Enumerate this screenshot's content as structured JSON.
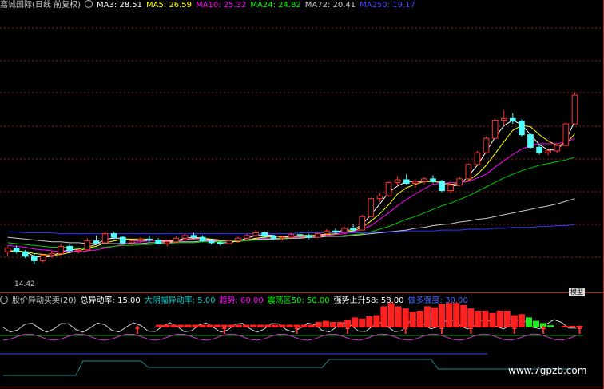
{
  "main_header": {
    "title": "嘉诚国际(日线 前复权)",
    "ma3": "MA3: 28.51",
    "ma5": "MA5: 26.59",
    "ma10": "MA10: 25.32",
    "ma24": "MA24: 24.82",
    "ma72": "MA72: 20.41",
    "ma250": "MA250: 19.17",
    "colors": {
      "title": "#c8c8c8",
      "ma3": "#ffffff",
      "ma5": "#ffff00",
      "ma10": "#ff00ff",
      "ma24": "#00ff00",
      "ma72": "#c8c8c8",
      "ma250": "#4444ff"
    }
  },
  "indicator_header": {
    "name": "股价异动买卖(20)",
    "total": "总异动率: 15.00",
    "big": "大阴幅异动率: 5.00",
    "trend": "趋势: 60.00",
    "zone": "震荡区50: 50.00",
    "strong": "强势上升58: 58.00",
    "bull": "做多强度: 30.00",
    "colors": {
      "name": "#c8c8c8",
      "total": "#ffffff",
      "big": "#00cccc",
      "trend": "#ff00ff",
      "zone": "#00ff00",
      "strong": "#ffffff",
      "bull": "#4466ff"
    }
  },
  "low_price_label": "14.42",
  "mini_tag": "模型",
  "watermark": "www.7gpzb.com",
  "chart_data": {
    "type": "candlestick",
    "price_range": [
      12,
      34
    ],
    "candles": [
      [
        15.8,
        16.4,
        15.3,
        16.2
      ],
      [
        16.2,
        16.5,
        15.6,
        15.8
      ],
      [
        15.8,
        16.0,
        15.1,
        15.3
      ],
      [
        15.3,
        15.6,
        14.4,
        14.8
      ],
      [
        14.8,
        15.6,
        14.6,
        15.4
      ],
      [
        15.4,
        15.9,
        15.1,
        15.6
      ],
      [
        15.6,
        16.7,
        15.4,
        16.4
      ],
      [
        16.4,
        16.6,
        15.7,
        15.9
      ],
      [
        15.9,
        16.3,
        15.6,
        16.0
      ],
      [
        16.0,
        17.3,
        15.9,
        17.0
      ],
      [
        17.0,
        17.6,
        16.5,
        16.8
      ],
      [
        16.8,
        18.1,
        16.7,
        17.8
      ],
      [
        17.8,
        18.0,
        17.2,
        17.4
      ],
      [
        17.4,
        17.5,
        16.6,
        16.8
      ],
      [
        16.8,
        17.1,
        16.5,
        17.0
      ],
      [
        17.0,
        17.4,
        16.8,
        17.2
      ],
      [
        17.2,
        17.6,
        16.9,
        17.1
      ],
      [
        17.1,
        17.3,
        16.6,
        16.7
      ],
      [
        16.7,
        17.0,
        16.4,
        16.9
      ],
      [
        16.9,
        17.5,
        16.8,
        17.3
      ],
      [
        17.3,
        17.8,
        17.1,
        17.6
      ],
      [
        17.6,
        17.9,
        17.2,
        17.4
      ],
      [
        17.4,
        17.6,
        16.9,
        17.0
      ],
      [
        17.0,
        17.2,
        16.6,
        16.8
      ],
      [
        16.8,
        17.0,
        16.5,
        16.7
      ],
      [
        16.7,
        17.1,
        16.6,
        17.0
      ],
      [
        17.0,
        17.5,
        16.8,
        17.3
      ],
      [
        17.3,
        17.8,
        17.1,
        17.6
      ],
      [
        17.6,
        18.2,
        17.4,
        17.9
      ],
      [
        17.9,
        18.0,
        17.3,
        17.5
      ],
      [
        17.5,
        17.7,
        17.1,
        17.3
      ],
      [
        17.3,
        17.6,
        17.0,
        17.4
      ],
      [
        17.4,
        17.9,
        17.2,
        17.7
      ],
      [
        17.7,
        18.0,
        17.4,
        17.6
      ],
      [
        17.6,
        17.8,
        17.2,
        17.4
      ],
      [
        17.4,
        17.9,
        17.3,
        17.8
      ],
      [
        17.8,
        18.3,
        17.6,
        18.1
      ],
      [
        18.1,
        18.4,
        17.8,
        18.0
      ],
      [
        18.0,
        18.6,
        17.9,
        18.4
      ],
      [
        18.4,
        18.9,
        18.1,
        18.2
      ],
      [
        18.2,
        19.9,
        18.2,
        19.7
      ],
      [
        19.7,
        21.8,
        19.6,
        21.7
      ],
      [
        21.7,
        22.3,
        21.3,
        22.0
      ],
      [
        22.0,
        23.6,
        21.9,
        23.5
      ],
      [
        23.5,
        24.2,
        23.1,
        23.8
      ],
      [
        23.8,
        24.4,
        23.2,
        23.4
      ],
      [
        23.4,
        23.9,
        22.9,
        23.6
      ],
      [
        23.6,
        24.1,
        23.3,
        23.9
      ],
      [
        23.9,
        24.3,
        23.4,
        23.6
      ],
      [
        23.6,
        23.8,
        22.4,
        22.6
      ],
      [
        22.6,
        23.4,
        22.3,
        23.2
      ],
      [
        23.2,
        24.1,
        23.1,
        23.9
      ],
      [
        23.9,
        25.6,
        23.8,
        25.5
      ],
      [
        25.5,
        27.0,
        25.4,
        26.8
      ],
      [
        26.8,
        28.6,
        26.7,
        28.4
      ],
      [
        28.4,
        30.6,
        28.3,
        30.4
      ],
      [
        30.4,
        31.5,
        29.8,
        30.6
      ],
      [
        30.6,
        31.2,
        30.0,
        30.3
      ],
      [
        30.3,
        30.5,
        28.6,
        28.8
      ],
      [
        28.8,
        29.0,
        27.2,
        27.4
      ],
      [
        27.4,
        27.8,
        26.6,
        26.8
      ],
      [
        26.8,
        27.3,
        26.5,
        27.0
      ],
      [
        27.0,
        27.8,
        26.8,
        27.6
      ],
      [
        27.6,
        30.2,
        27.5,
        30.0
      ],
      [
        30.0,
        33.5,
        29.9,
        33.2
      ]
    ],
    "lines": {
      "MA3": [
        15.9,
        15.8,
        15.8,
        15.3,
        15.2,
        15.3,
        15.8,
        16.0,
        16.1,
        16.3,
        16.6,
        17.2,
        17.3,
        17.3,
        17.1,
        17.0,
        17.1,
        17.0,
        16.9,
        17.0,
        17.3,
        17.4,
        17.3,
        17.1,
        16.8,
        16.8,
        17.0,
        17.3,
        17.6,
        17.7,
        17.6,
        17.4,
        17.5,
        17.6,
        17.6,
        17.6,
        17.8,
        18.0,
        18.2,
        18.2,
        18.8,
        19.9,
        21.1,
        22.4,
        23.1,
        23.6,
        23.6,
        23.6,
        23.7,
        23.4,
        23.1,
        23.2,
        24.2,
        25.4,
        26.9,
        28.5,
        29.8,
        30.4,
        29.9,
        28.8,
        27.7,
        27.1,
        27.1,
        28.2,
        30.3
      ],
      "MA5": [
        15.9,
        15.9,
        15.8,
        15.6,
        15.5,
        15.4,
        15.5,
        15.7,
        15.9,
        16.2,
        16.4,
        16.8,
        17.0,
        17.2,
        17.2,
        17.2,
        17.2,
        17.0,
        17.0,
        17.0,
        17.1,
        17.3,
        17.3,
        17.2,
        17.1,
        17.0,
        16.9,
        17.1,
        17.3,
        17.4,
        17.5,
        17.5,
        17.5,
        17.5,
        17.5,
        17.6,
        17.7,
        17.8,
        18.0,
        18.1,
        18.5,
        19.2,
        20.0,
        21.0,
        22.2,
        22.9,
        23.3,
        23.6,
        23.6,
        23.5,
        23.3,
        23.4,
        23.7,
        24.4,
        25.4,
        26.7,
        28.0,
        29.3,
        29.8,
        29.7,
        28.8,
        28.1,
        27.6,
        27.8,
        28.9
      ],
      "MA10": [
        16.5,
        16.4,
        16.3,
        16.1,
        16.0,
        15.9,
        15.8,
        15.8,
        15.8,
        15.9,
        16.0,
        16.2,
        16.4,
        16.6,
        16.8,
        16.9,
        17.0,
        17.1,
        17.1,
        17.1,
        17.1,
        17.2,
        17.1,
        17.1,
        17.0,
        17.0,
        17.1,
        17.1,
        17.2,
        17.3,
        17.3,
        17.3,
        17.4,
        17.4,
        17.4,
        17.5,
        17.6,
        17.7,
        17.8,
        18.0,
        18.3,
        18.7,
        19.4,
        20.1,
        20.9,
        21.6,
        22.2,
        22.8,
        23.3,
        23.4,
        23.5,
        23.5,
        23.6,
        24.0,
        24.4,
        25.2,
        25.9,
        26.6,
        27.2,
        27.6,
        27.8,
        27.8,
        27.8,
        28.0,
        28.4
      ],
      "MA24": [
        16.8,
        16.7,
        16.6,
        16.5,
        16.4,
        16.3,
        16.3,
        16.3,
        16.2,
        16.2,
        16.2,
        16.3,
        16.4,
        16.5,
        16.5,
        16.6,
        16.6,
        16.7,
        16.7,
        16.8,
        16.8,
        16.8,
        16.9,
        16.9,
        16.9,
        17.0,
        17.0,
        17.0,
        17.1,
        17.1,
        17.2,
        17.2,
        17.3,
        17.3,
        17.4,
        17.4,
        17.5,
        17.5,
        17.6,
        17.7,
        17.8,
        18.0,
        18.3,
        18.6,
        19.0,
        19.4,
        19.7,
        20.1,
        20.5,
        20.9,
        21.2,
        21.6,
        22.0,
        22.5,
        23.0,
        23.5,
        24.0,
        24.4,
        24.8,
        25.1,
        25.4,
        25.6,
        25.8,
        26.0,
        26.3
      ],
      "MA72": [
        17.4,
        17.3,
        17.2,
        17.1,
        17.0,
        16.9,
        16.9,
        16.8,
        16.8,
        16.7,
        16.7,
        16.7,
        16.7,
        16.7,
        16.7,
        16.7,
        16.8,
        16.8,
        16.8,
        16.9,
        16.9,
        16.9,
        17.0,
        17.0,
        17.0,
        17.1,
        17.1,
        17.1,
        17.2,
        17.2,
        17.2,
        17.3,
        17.3,
        17.3,
        17.4,
        17.4,
        17.5,
        17.5,
        17.5,
        17.6,
        17.7,
        17.8,
        17.9,
        18.0,
        18.1,
        18.2,
        18.4,
        18.5,
        18.7,
        18.8,
        18.9,
        19.1,
        19.2,
        19.4,
        19.5,
        19.7,
        19.9,
        20.1,
        20.3,
        20.5,
        20.7,
        20.9,
        21.1,
        21.4,
        21.7
      ],
      "MA250": [
        18.0,
        18.0,
        17.9,
        17.9,
        17.9,
        17.9,
        17.8,
        17.8,
        17.8,
        17.8,
        17.8,
        17.8,
        17.8,
        17.8,
        17.8,
        17.8,
        17.8,
        17.8,
        17.8,
        17.8,
        17.8,
        17.8,
        17.8,
        17.8,
        17.8,
        17.8,
        17.8,
        17.8,
        17.8,
        17.8,
        17.8,
        17.8,
        17.8,
        17.9,
        17.9,
        17.9,
        17.9,
        17.9,
        17.9,
        17.9,
        17.9,
        17.9,
        18.0,
        18.0,
        18.0,
        18.1,
        18.1,
        18.1,
        18.1,
        18.2,
        18.2,
        18.2,
        18.3,
        18.3,
        18.3,
        18.4,
        18.4,
        18.5,
        18.5,
        18.5,
        18.6,
        18.6,
        18.7,
        18.7,
        18.8
      ]
    },
    "indicator": {
      "range": [
        0,
        100
      ],
      "red_bars": [
        0,
        0,
        0,
        0,
        0,
        0,
        0,
        0,
        0,
        0,
        0,
        0,
        0,
        0,
        0,
        0,
        0,
        0,
        0,
        0,
        0,
        5,
        5,
        5,
        5,
        5,
        5,
        5,
        5,
        5,
        5,
        5,
        5,
        5,
        5,
        5,
        5,
        5,
        5,
        5,
        5,
        5,
        5,
        10,
        12,
        10,
        10,
        14,
        18,
        16,
        20,
        22,
        38,
        44,
        38,
        34,
        28,
        30,
        38,
        36,
        42,
        44,
        44,
        40,
        34,
        30,
        30,
        26,
        30,
        30,
        22,
        24,
        0,
        0,
        0,
        0,
        0,
        3,
        3,
        3
      ],
      "green_bars": [
        0,
        0,
        0,
        0,
        0,
        0,
        0,
        0,
        0,
        0,
        0,
        0,
        0,
        0,
        0,
        0,
        0,
        0,
        0,
        0,
        0,
        0,
        0,
        0,
        0,
        0,
        0,
        0,
        0,
        0,
        0,
        0,
        0,
        0,
        0,
        0,
        0,
        0,
        0,
        0,
        0,
        0,
        0,
        0,
        0,
        0,
        0,
        0,
        0,
        0,
        0,
        0,
        0,
        0,
        0,
        0,
        0,
        0,
        0,
        0,
        0,
        0,
        0,
        0,
        0,
        0,
        0,
        0,
        0,
        0,
        0,
        0,
        18,
        12,
        8,
        4,
        0,
        0,
        0,
        0
      ],
      "arrow_positions": [
        18,
        30,
        40,
        47,
        55,
        60,
        64,
        70,
        74,
        79
      ],
      "level_lines": {
        "green": 20,
        "blue": 36
      }
    }
  }
}
